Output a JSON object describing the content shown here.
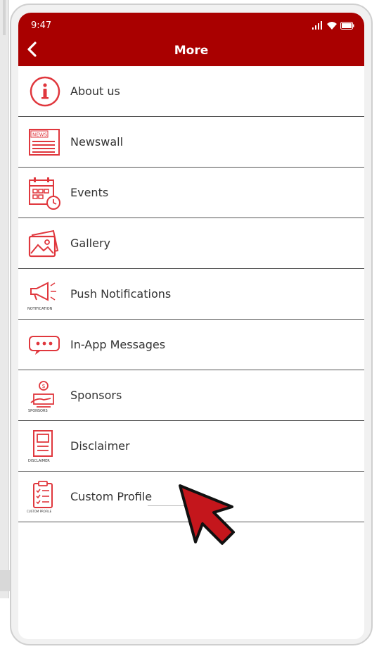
{
  "status": {
    "time": "9:47"
  },
  "header": {
    "title": "More"
  },
  "menu": [
    {
      "label": "About us",
      "icon": "info-icon"
    },
    {
      "label": "Newswall",
      "icon": "news-icon",
      "icon_text": "NEWS"
    },
    {
      "label": "Events",
      "icon": "calendar-clock-icon"
    },
    {
      "label": "Gallery",
      "icon": "gallery-icon"
    },
    {
      "label": "Push Notifications",
      "icon": "megaphone-icon",
      "icon_caption": "NOTIFICATION"
    },
    {
      "label": "In-App Messages",
      "icon": "chat-bubble-icon"
    },
    {
      "label": "Sponsors",
      "icon": "sponsor-icon",
      "icon_caption": "SPONSORS"
    },
    {
      "label": "Disclaimer",
      "icon": "document-icon",
      "icon_caption": "DISCLAIMER"
    },
    {
      "label": "Custom Profile",
      "icon": "clipboard-icon",
      "icon_caption": "CUSTOM PROFILE"
    }
  ],
  "colors": {
    "header": "#a90000",
    "icon_red": "#e0373d",
    "divider": "#555555",
    "text": "#333333"
  }
}
